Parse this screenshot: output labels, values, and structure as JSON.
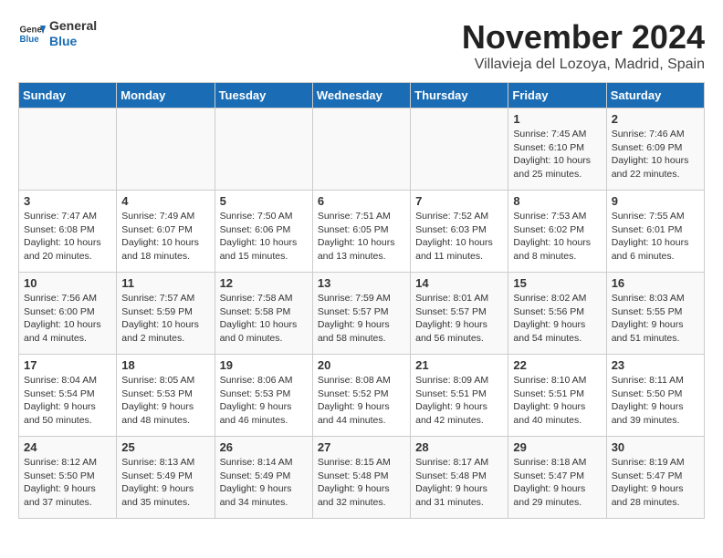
{
  "logo": {
    "general": "General",
    "blue": "Blue"
  },
  "title": "November 2024",
  "location": "Villavieja del Lozoya, Madrid, Spain",
  "days_of_week": [
    "Sunday",
    "Monday",
    "Tuesday",
    "Wednesday",
    "Thursday",
    "Friday",
    "Saturday"
  ],
  "weeks": [
    [
      {
        "day": "",
        "info": ""
      },
      {
        "day": "",
        "info": ""
      },
      {
        "day": "",
        "info": ""
      },
      {
        "day": "",
        "info": ""
      },
      {
        "day": "",
        "info": ""
      },
      {
        "day": "1",
        "info": "Sunrise: 7:45 AM\nSunset: 6:10 PM\nDaylight: 10 hours and 25 minutes."
      },
      {
        "day": "2",
        "info": "Sunrise: 7:46 AM\nSunset: 6:09 PM\nDaylight: 10 hours and 22 minutes."
      }
    ],
    [
      {
        "day": "3",
        "info": "Sunrise: 7:47 AM\nSunset: 6:08 PM\nDaylight: 10 hours and 20 minutes."
      },
      {
        "day": "4",
        "info": "Sunrise: 7:49 AM\nSunset: 6:07 PM\nDaylight: 10 hours and 18 minutes."
      },
      {
        "day": "5",
        "info": "Sunrise: 7:50 AM\nSunset: 6:06 PM\nDaylight: 10 hours and 15 minutes."
      },
      {
        "day": "6",
        "info": "Sunrise: 7:51 AM\nSunset: 6:05 PM\nDaylight: 10 hours and 13 minutes."
      },
      {
        "day": "7",
        "info": "Sunrise: 7:52 AM\nSunset: 6:03 PM\nDaylight: 10 hours and 11 minutes."
      },
      {
        "day": "8",
        "info": "Sunrise: 7:53 AM\nSunset: 6:02 PM\nDaylight: 10 hours and 8 minutes."
      },
      {
        "day": "9",
        "info": "Sunrise: 7:55 AM\nSunset: 6:01 PM\nDaylight: 10 hours and 6 minutes."
      }
    ],
    [
      {
        "day": "10",
        "info": "Sunrise: 7:56 AM\nSunset: 6:00 PM\nDaylight: 10 hours and 4 minutes."
      },
      {
        "day": "11",
        "info": "Sunrise: 7:57 AM\nSunset: 5:59 PM\nDaylight: 10 hours and 2 minutes."
      },
      {
        "day": "12",
        "info": "Sunrise: 7:58 AM\nSunset: 5:58 PM\nDaylight: 10 hours and 0 minutes."
      },
      {
        "day": "13",
        "info": "Sunrise: 7:59 AM\nSunset: 5:57 PM\nDaylight: 9 hours and 58 minutes."
      },
      {
        "day": "14",
        "info": "Sunrise: 8:01 AM\nSunset: 5:57 PM\nDaylight: 9 hours and 56 minutes."
      },
      {
        "day": "15",
        "info": "Sunrise: 8:02 AM\nSunset: 5:56 PM\nDaylight: 9 hours and 54 minutes."
      },
      {
        "day": "16",
        "info": "Sunrise: 8:03 AM\nSunset: 5:55 PM\nDaylight: 9 hours and 51 minutes."
      }
    ],
    [
      {
        "day": "17",
        "info": "Sunrise: 8:04 AM\nSunset: 5:54 PM\nDaylight: 9 hours and 50 minutes."
      },
      {
        "day": "18",
        "info": "Sunrise: 8:05 AM\nSunset: 5:53 PM\nDaylight: 9 hours and 48 minutes."
      },
      {
        "day": "19",
        "info": "Sunrise: 8:06 AM\nSunset: 5:53 PM\nDaylight: 9 hours and 46 minutes."
      },
      {
        "day": "20",
        "info": "Sunrise: 8:08 AM\nSunset: 5:52 PM\nDaylight: 9 hours and 44 minutes."
      },
      {
        "day": "21",
        "info": "Sunrise: 8:09 AM\nSunset: 5:51 PM\nDaylight: 9 hours and 42 minutes."
      },
      {
        "day": "22",
        "info": "Sunrise: 8:10 AM\nSunset: 5:51 PM\nDaylight: 9 hours and 40 minutes."
      },
      {
        "day": "23",
        "info": "Sunrise: 8:11 AM\nSunset: 5:50 PM\nDaylight: 9 hours and 39 minutes."
      }
    ],
    [
      {
        "day": "24",
        "info": "Sunrise: 8:12 AM\nSunset: 5:50 PM\nDaylight: 9 hours and 37 minutes."
      },
      {
        "day": "25",
        "info": "Sunrise: 8:13 AM\nSunset: 5:49 PM\nDaylight: 9 hours and 35 minutes."
      },
      {
        "day": "26",
        "info": "Sunrise: 8:14 AM\nSunset: 5:49 PM\nDaylight: 9 hours and 34 minutes."
      },
      {
        "day": "27",
        "info": "Sunrise: 8:15 AM\nSunset: 5:48 PM\nDaylight: 9 hours and 32 minutes."
      },
      {
        "day": "28",
        "info": "Sunrise: 8:17 AM\nSunset: 5:48 PM\nDaylight: 9 hours and 31 minutes."
      },
      {
        "day": "29",
        "info": "Sunrise: 8:18 AM\nSunset: 5:47 PM\nDaylight: 9 hours and 29 minutes."
      },
      {
        "day": "30",
        "info": "Sunrise: 8:19 AM\nSunset: 5:47 PM\nDaylight: 9 hours and 28 minutes."
      }
    ]
  ]
}
